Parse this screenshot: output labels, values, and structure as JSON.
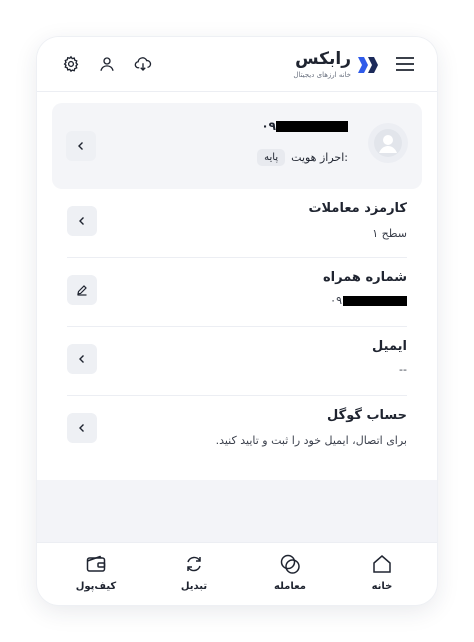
{
  "header": {
    "logo_text": "رابکس",
    "logo_subtitle": "خانه ارزهای دیجیتال",
    "icons": [
      "menu-icon",
      "download-app-icon",
      "user-icon",
      "settings-icon"
    ]
  },
  "profile": {
    "phone_prefix": "۰۹",
    "verify_label": "احراز هویت:",
    "verify_level": "پایه"
  },
  "rows": {
    "fee": {
      "title": "کارمزد معاملات",
      "value": "سطح ۱"
    },
    "mobile": {
      "title": "شماره همراه",
      "value_prefix": "۰۹"
    },
    "email": {
      "title": "ایمیل",
      "value": "--"
    },
    "google": {
      "title": "حساب گوگل",
      "value": "برای اتصال، ایمیل خود را ثبت و تایید کنید."
    }
  },
  "bottom_nav": {
    "home": "خانه",
    "trade": "معامله",
    "convert": "تبدیل",
    "wallet": "کیف‌پول"
  },
  "colors": {
    "brand_blue": "#2f5bea",
    "brand_dark": "#1c2a5a"
  }
}
